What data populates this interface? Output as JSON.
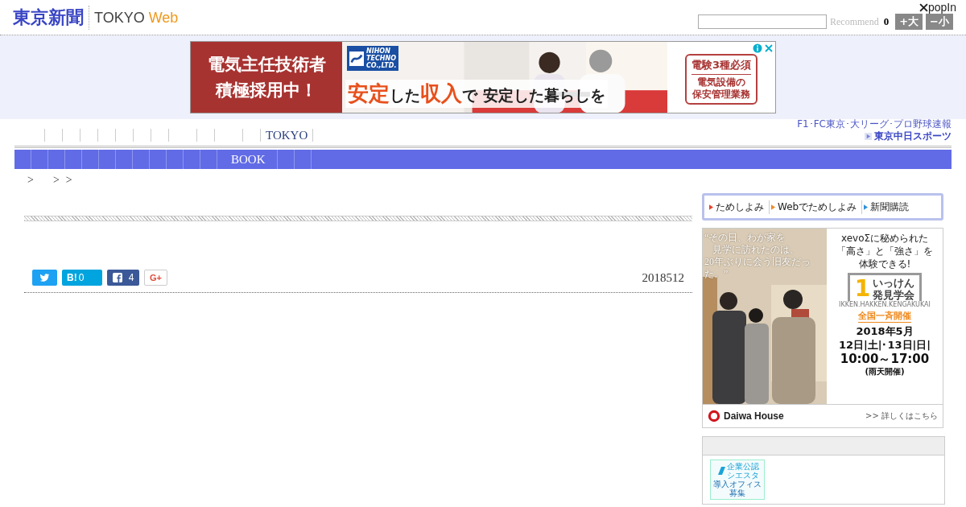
{
  "header": {
    "logo": "東京新聞",
    "brand": "TOKYO",
    "brand_accent": "Web",
    "recommend": "Recommend",
    "count": "0",
    "font_buttons": [
      "+大",
      "−小"
    ],
    "popin": "popIn"
  },
  "banner_ad": {
    "left_lines": [
      "電気主任技術者",
      "積極採用中！"
    ],
    "company_lines": [
      "NIHON",
      "TECHNO",
      "CO.,LTD."
    ],
    "headline": [
      {
        "text": "安定",
        "emphasis": true
      },
      {
        "text": "した",
        "emphasis": false
      },
      {
        "text": "収入",
        "emphasis": true
      },
      {
        "text": "で 安定した暮らしを",
        "emphasis": false
      }
    ],
    "badge": "電験3種必須",
    "badge_lines": [
      "電気設備の",
      "保安管理業務"
    ]
  },
  "nav": {
    "items": [
      {
        "label": "TOKYO"
      }
    ],
    "sports_caption": "F1･FC東京･大リーグ･プロ野球速報",
    "sports_link": "東京中日スポーツ"
  },
  "category_bar": {
    "items": [
      {
        "label": "BOOK"
      }
    ]
  },
  "breadcrumb": [
    ">",
    ">",
    ">"
  ],
  "article": {
    "share": {
      "hatena": "B!",
      "hatena_count": "0",
      "facebook_count": "4",
      "google": "G+"
    },
    "date": "2018512"
  },
  "sidebar": {
    "tabs": [
      {
        "label": "ためしよみ",
        "color": "#e8412c"
      },
      {
        "label": "Webでためしよみ",
        "color": "#f08a24"
      },
      {
        "label": "新聞購読",
        "color": "#2f8fd8"
      }
    ],
    "ad": {
      "quote_lines": [
        "“その日、わが家を",
        "見学に訪れたのは、",
        "20年ぶりに会う旧友だった。”"
      ],
      "copy_lines": [
        "xevoΣに秘められた",
        "「高さ」と「強さ」を",
        "体験できる!"
      ],
      "event_mark": "1",
      "event_lines": [
        "いっけん",
        "発見学会"
      ],
      "event_romaji": "IKKEN.HAKKEN.KENGAKUKAI",
      "event_tag": "全国一斉開催",
      "date_lines": [
        "2018年5月",
        "12日|土|･13日|日|",
        "10:00～17:00",
        "(雨天開催)"
      ],
      "brand": "Daiwa House",
      "more": ">> 詳しくはこちら"
    },
    "promo": {
      "top_lines": [
        "企業公認",
        "シエスタ"
      ],
      "bottom_lines": [
        "導入オフィス",
        "募集"
      ]
    }
  }
}
